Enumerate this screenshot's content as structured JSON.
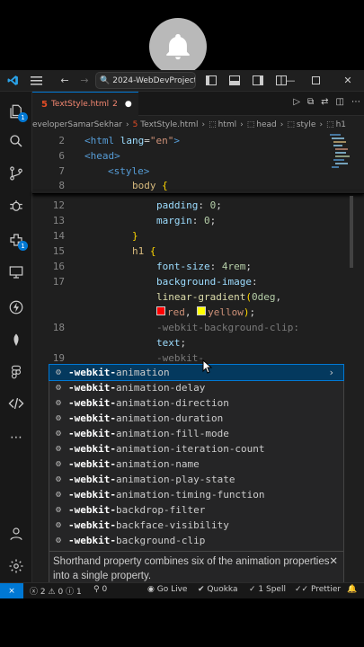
{
  "window": {
    "search_text": "2024-WebDevProjects"
  },
  "tab": {
    "filename": "TextStyle.html",
    "count": "2"
  },
  "breadcrumb": {
    "root": "eveloperSamarSekhar",
    "file": "TextStyle.html",
    "c1": "html",
    "c2": "head",
    "c3": "style",
    "c4": "h1"
  },
  "code": [
    {
      "n": "2",
      "t": "<html lang=\"en\">"
    },
    {
      "n": "6",
      "t": "<head>"
    },
    {
      "n": "7",
      "t": "<style>"
    },
    {
      "n": "8",
      "t": "body {"
    },
    {
      "n": "12",
      "t": "padding: 0;"
    },
    {
      "n": "13",
      "t": "margin: 0;"
    },
    {
      "n": "14",
      "t": "}"
    },
    {
      "n": "15",
      "t": "h1 {"
    },
    {
      "n": "16",
      "t": "font-size: 4rem;"
    },
    {
      "n": "17",
      "t": "background-image:"
    },
    {
      "n": "",
      "t": "linear-gradient(0deg,"
    },
    {
      "n": "",
      "t": "red, yellow);"
    },
    {
      "n": "18",
      "t": "-webkit-background-clip:"
    },
    {
      "n": "",
      "t": "text;"
    },
    {
      "n": "19",
      "t": "-webkit-"
    }
  ],
  "suggestions": {
    "prefix": "-webkit-",
    "items": [
      "animation",
      "animation-delay",
      "animation-direction",
      "animation-duration",
      "animation-fill-mode",
      "animation-iteration-count",
      "animation-name",
      "animation-play-state",
      "animation-timing-function",
      "backdrop-filter",
      "backface-visibility",
      "background-clip"
    ],
    "doc": "Shorthand property combines six of the animation properties into a single property."
  },
  "status": {
    "errors": "2",
    "warnings": "0",
    "info": "1",
    "ports": "0",
    "golive": "Go Live",
    "quokka": "Quokka",
    "spell": "1 Spell",
    "prettier": "Prettier"
  },
  "colors": {
    "accent": "#0078d4",
    "editor_bg": "#1f1f1f"
  }
}
